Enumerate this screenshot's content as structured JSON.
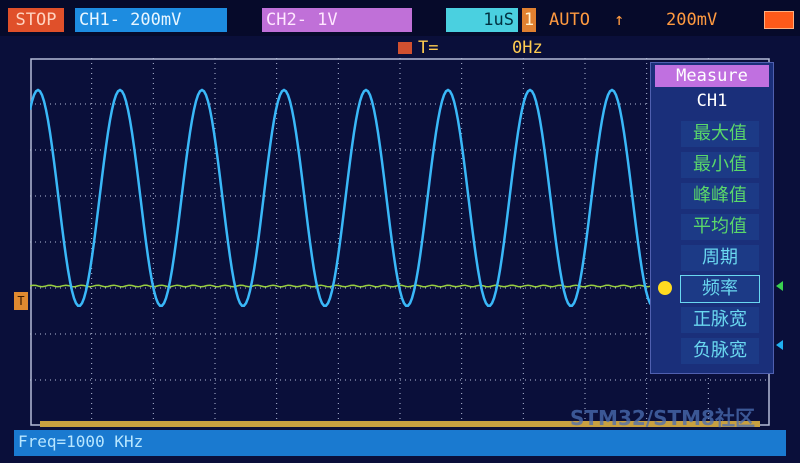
{
  "status": {
    "run_state": "STOP",
    "ch1": "CH1- 200mV",
    "ch2": "CH2-  1V",
    "timebase": "1uS",
    "trigger_source": "1",
    "trigger_mode": "AUTO",
    "trigger_edge": "↑",
    "trigger_level": "200mV"
  },
  "frequency": {
    "label": "T=",
    "value": "0Hz"
  },
  "menu": {
    "title": "Measure",
    "channel": "CH1",
    "items": [
      {
        "label": "最大值"
      },
      {
        "label": "最小值"
      },
      {
        "label": "峰峰值"
      },
      {
        "label": "平均值"
      },
      {
        "label": "周期"
      },
      {
        "label": "频率"
      },
      {
        "label": "正脉宽"
      },
      {
        "label": "负脉宽"
      }
    ],
    "selected_index": 5
  },
  "markers": {
    "trigger": "T"
  },
  "bottom": {
    "readout": "Freq=1000 KHz"
  },
  "watermark": "STM32/STM8社区",
  "colors": {
    "ch1": "#1d8ce0",
    "ch2": "#c070d8",
    "wave": "#3ab8f8",
    "trace2": "#9ad040",
    "grid": "#b4bcd8"
  }
}
